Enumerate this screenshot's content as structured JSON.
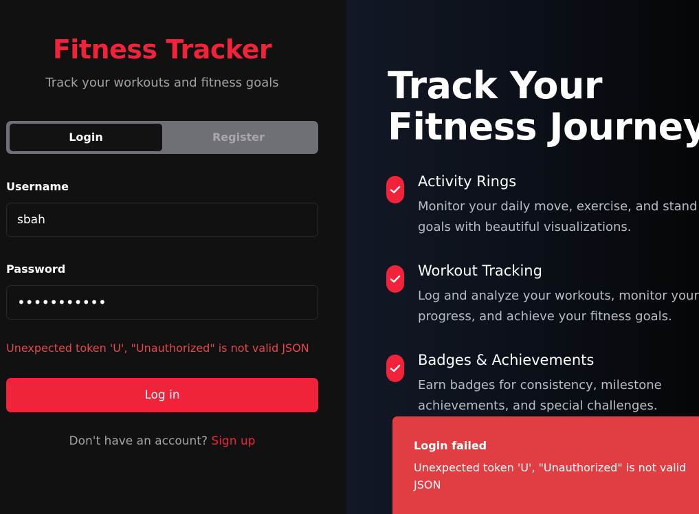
{
  "app": {
    "title": "Fitness Tracker",
    "subtitle": "Track your workouts and fitness goals"
  },
  "tabs": {
    "login_label": "Login",
    "register_label": "Register",
    "active": "Login"
  },
  "form": {
    "username_label": "Username",
    "username_value": "sbah",
    "password_label": "Password",
    "password_value": "•••••••••••",
    "error": "Unexpected token 'U', \"Unauthorized\" is not valid JSON",
    "submit_label": "Log in",
    "signup_prompt": "Don't have an account?",
    "signup_link": "Sign up"
  },
  "hero": {
    "title_line1": "Track Your",
    "title_line2": "Fitness Journey",
    "features": [
      {
        "icon": "check-icon",
        "title": "Activity Rings",
        "description": "Monitor your daily move, exercise, and stand goals with beautiful visualizations."
      },
      {
        "icon": "check-icon",
        "title": "Workout Tracking",
        "description": "Log and analyze your workouts, monitor your progress, and achieve your fitness goals."
      },
      {
        "icon": "check-icon",
        "title": "Badges & Achievements",
        "description": "Earn badges for consistency, milestone achievements, and special challenges."
      }
    ]
  },
  "toast": {
    "title": "Login failed",
    "message": "Unexpected token 'U', \"Unauthorized\" is not valid JSON"
  },
  "colors": {
    "accent": "#f0233a",
    "error_text": "#e5484d",
    "toast_bg": "#e03e42",
    "left_bg": "#111111",
    "right_bg": "#0b0f17"
  }
}
